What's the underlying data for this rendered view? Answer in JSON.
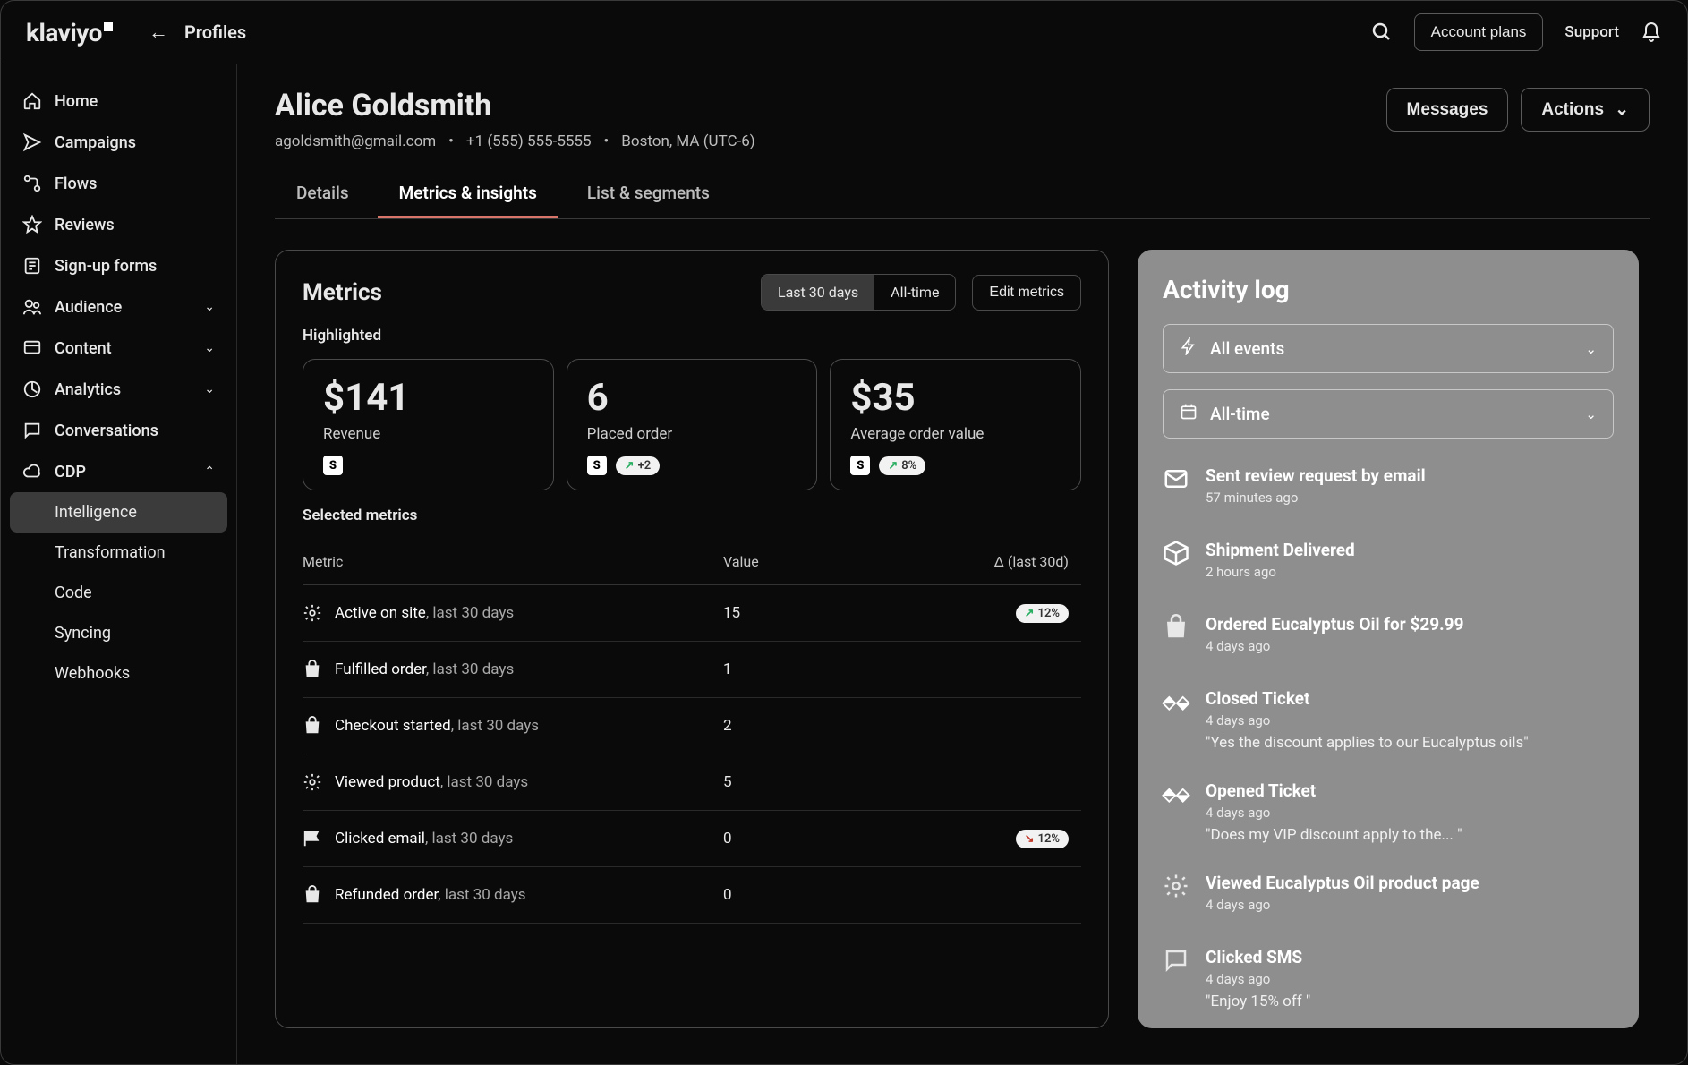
{
  "topbar": {
    "logo": "klaviyo",
    "breadcrumb": "Profiles",
    "account_plans": "Account plans",
    "support": "Support"
  },
  "sidebar": {
    "items": [
      {
        "label": "Home",
        "icon": "home"
      },
      {
        "label": "Campaigns",
        "icon": "send"
      },
      {
        "label": "Flows",
        "icon": "flow"
      },
      {
        "label": "Reviews",
        "icon": "star"
      },
      {
        "label": "Sign-up forms",
        "icon": "form"
      },
      {
        "label": "Audience",
        "icon": "people",
        "expand": true
      },
      {
        "label": "Content",
        "icon": "content",
        "expand": true
      },
      {
        "label": "Analytics",
        "icon": "analytics",
        "expand": true
      },
      {
        "label": "Conversations",
        "icon": "chat"
      },
      {
        "label": "CDP",
        "icon": "cloud",
        "expand": true,
        "open": true
      }
    ],
    "cdp_children": [
      {
        "label": "Intelligence",
        "active": true
      },
      {
        "label": "Transformation"
      },
      {
        "label": "Code"
      },
      {
        "label": "Syncing"
      },
      {
        "label": "Webhooks"
      }
    ]
  },
  "profile": {
    "name": "Alice Goldsmith",
    "email": "agoldsmith@gmail.com",
    "phone": "+1 (555) 555-5555",
    "location": "Boston, MA (UTC-6)",
    "messages_btn": "Messages",
    "actions_btn": "Actions"
  },
  "tabs": [
    {
      "label": "Details"
    },
    {
      "label": "Metrics & insights",
      "active": true
    },
    {
      "label": "List & segments"
    }
  ],
  "metrics": {
    "title": "Metrics",
    "range": [
      {
        "label": "Last 30 days",
        "active": true
      },
      {
        "label": "All-time"
      }
    ],
    "edit": "Edit metrics",
    "highlighted_label": "Highlighted",
    "cards": [
      {
        "value": "$141",
        "label": "Revenue",
        "source": "shopify"
      },
      {
        "value": "6",
        "label": "Placed order",
        "source": "shopify",
        "pill": "+2",
        "dir": "up"
      },
      {
        "value": "$35",
        "label": "Average order value",
        "source": "shopify",
        "pill": "8%",
        "dir": "up"
      }
    ],
    "selected_label": "Selected metrics",
    "table_headers": {
      "metric": "Metric",
      "value": "Value",
      "delta": "Δ (last 30d)"
    },
    "rows": [
      {
        "icon": "gear",
        "name": "Active on site",
        "suffix": ", last 30 days",
        "value": "15",
        "delta": "12%",
        "dir": "up"
      },
      {
        "icon": "bag",
        "name": "Fulfilled order",
        "suffix": ", last 30 days",
        "value": "1"
      },
      {
        "icon": "bag",
        "name": "Checkout started",
        "suffix": ", last 30 days",
        "value": "2"
      },
      {
        "icon": "gear",
        "name": "Viewed product",
        "suffix": ", last 30 days",
        "value": "5"
      },
      {
        "icon": "flag",
        "name": "Clicked email",
        "suffix": ", last 30 days",
        "value": "0",
        "delta": "12%",
        "dir": "down"
      },
      {
        "icon": "bag",
        "name": "Refunded order",
        "suffix": ", last 30 days",
        "value": "0"
      }
    ]
  },
  "activity": {
    "title": "Activity log",
    "filter_event": "All events",
    "filter_time": "All-time",
    "feed": [
      {
        "icon": "mail",
        "title": "Sent review request by email",
        "time": "57 minutes ago"
      },
      {
        "icon": "box",
        "title": "Shipment Delivered",
        "time": "2 hours ago"
      },
      {
        "icon": "bag",
        "title": "Ordered Eucalyptus Oil for $29.99",
        "time": "4 days ago"
      },
      {
        "icon": "zendesk",
        "title": "Closed Ticket",
        "time": "4 days ago",
        "quote": "\"Yes the discount applies to our Eucalyptus oils\""
      },
      {
        "icon": "zendesk",
        "title": "Opened Ticket",
        "time": "4 days ago",
        "quote": "\"Does my VIP discount apply to the... \""
      },
      {
        "icon": "gear",
        "title": "Viewed Eucalyptus Oil product page",
        "time": "4 days ago"
      },
      {
        "icon": "chat",
        "title": "Clicked SMS",
        "time": "4 days ago",
        "quote": "\"Enjoy 15% off \""
      }
    ]
  }
}
